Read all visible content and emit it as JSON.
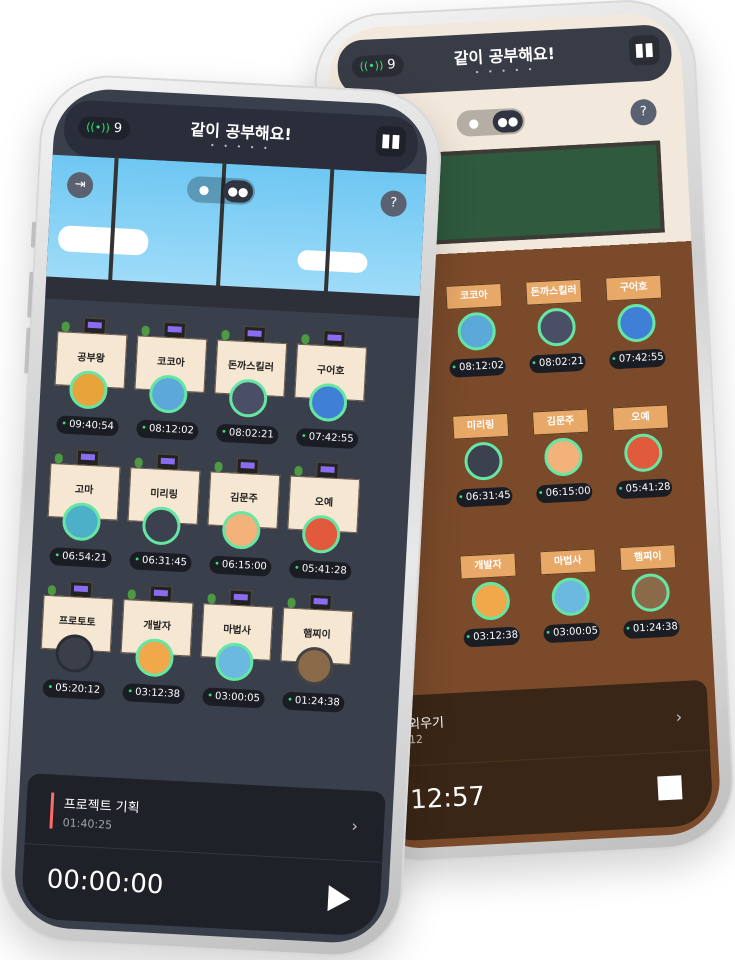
{
  "app": {
    "title": "같이 공부해요!",
    "live_count": "9",
    "live_icon": "live-signal-icon",
    "page_dots": "• • • • •"
  },
  "front": {
    "desks": [
      {
        "name": "공부왕",
        "time": "09:40:54"
      },
      {
        "name": "코코아",
        "time": "08:12:02"
      },
      {
        "name": "돈까스킬러",
        "time": "08:02:21"
      },
      {
        "name": "구어호",
        "time": "07:42:55"
      },
      {
        "name": "고마",
        "time": "06:54:21"
      },
      {
        "name": "미리링",
        "time": "06:31:45"
      },
      {
        "name": "김문주",
        "time": "06:15:00"
      },
      {
        "name": "오예",
        "time": "05:41:28"
      },
      {
        "name": "프로토토",
        "time": "05:20:12"
      },
      {
        "name": "개발자",
        "time": "03:12:38"
      },
      {
        "name": "마법사",
        "time": "03:00:05"
      },
      {
        "name": "햄찌이",
        "time": "01:24:38"
      }
    ],
    "task": {
      "name": "프로젝트 기획",
      "elapsed": "01:40:25"
    },
    "timer": "00:00:00"
  },
  "back": {
    "desks": [
      {
        "name": "코코아",
        "time": "08:12:02"
      },
      {
        "name": "돈까스킬러",
        "time": "08:02:21"
      },
      {
        "name": "구어호",
        "time": "07:42:55"
      },
      {
        "name": "미리링",
        "time": "06:31:45"
      },
      {
        "name": "김문주",
        "time": "06:15:00"
      },
      {
        "name": "오예",
        "time": "05:41:28"
      },
      {
        "name": "개발자",
        "time": "03:12:38"
      },
      {
        "name": "마법사",
        "time": "03:00:05"
      },
      {
        "name": "햄찌이",
        "time": "01:24:38"
      }
    ],
    "task_fragment": "외우기",
    "task_elapsed_fragment": "12",
    "timer_fragment": "12:57"
  },
  "icons": {
    "stats": "bar-chart-icon",
    "exit": "exit-icon",
    "help": "help-icon",
    "solo": "person-icon",
    "group": "group-icon",
    "play": "play-icon",
    "stop": "stop-icon"
  },
  "colors": {
    "live_green": "#36e07a",
    "avatar_ring": "#65e6a3",
    "task_accent": "#ff6a6a"
  }
}
